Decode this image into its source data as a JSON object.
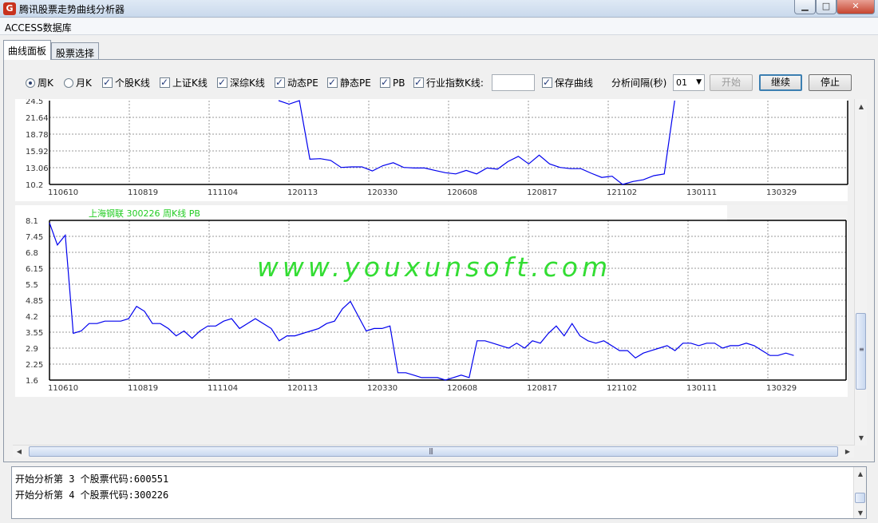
{
  "window": {
    "title": "腾讯股票走势曲线分析器",
    "icon": "app-logo-icon"
  },
  "menu": {
    "label": "ACCESS数据库"
  },
  "tabs": [
    {
      "label": "曲线面板"
    },
    {
      "label": "股票选择"
    }
  ],
  "options": {
    "week_k": {
      "label": "周K",
      "checked": true
    },
    "month_k": {
      "label": "月K",
      "checked": false
    },
    "stock_k": {
      "label": "个股K线",
      "checked": true
    },
    "sh_k": {
      "label": "上证K线",
      "checked": true
    },
    "sz_k": {
      "label": "深综K线",
      "checked": true
    },
    "dyn_pe": {
      "label": "动态PE",
      "checked": true
    },
    "static_pe": {
      "label": "静态PE",
      "checked": true
    },
    "pb": {
      "label": "PB",
      "checked": true
    },
    "industry_k": {
      "label": "行业指数K线:",
      "checked": true,
      "value": ""
    },
    "save_curve": {
      "label": "保存曲线",
      "checked": true
    },
    "interval_label": "分析间隔(秒)",
    "interval_value": "01"
  },
  "buttons": {
    "start": "开始",
    "continue": "继续",
    "stop": "停止"
  },
  "watermark": "www.youxunsoft.com",
  "chart_data": [
    {
      "type": "line",
      "title": "",
      "categories": [
        "110610",
        "110819",
        "111104",
        "120113",
        "120330",
        "120608",
        "120817",
        "121102",
        "130111",
        "130329"
      ],
      "y_ticks": [
        "24.5",
        "21.64",
        "18.78",
        "15.92",
        "13.06",
        "10.2"
      ],
      "ylim": [
        10.2,
        24.5
      ],
      "grid": true,
      "series": [
        {
          "color": "#0000ee",
          "values": [
            24.5,
            23.9,
            24.5,
            14.5,
            14.6,
            14.3,
            13.1,
            13.2,
            13.2,
            12.5,
            13.4,
            13.9,
            13.1,
            13.0,
            13.0,
            12.6,
            12.2,
            12.0,
            12.6,
            12.0,
            13.0,
            12.8,
            14.1,
            15.0,
            13.7,
            15.2,
            13.7,
            13.1,
            12.9,
            12.9,
            12.1,
            11.4,
            11.6,
            10.2,
            10.7,
            11.0,
            11.7,
            12.0,
            24.5
          ]
        }
      ]
    },
    {
      "type": "line",
      "title": "上海钢联  300226  周K线  PB",
      "categories": [
        "110610",
        "110819",
        "111104",
        "120113",
        "120330",
        "120608",
        "120817",
        "121102",
        "130111",
        "130329"
      ],
      "y_ticks": [
        "8.1",
        "7.45",
        "6.8",
        "6.15",
        "5.5",
        "4.85",
        "4.2",
        "3.55",
        "2.9",
        "2.25",
        "1.6"
      ],
      "ylim": [
        1.6,
        8.1
      ],
      "grid": true,
      "series": [
        {
          "name": "上海钢联 300226",
          "color": "#0000ee",
          "values": [
            8.0,
            7.1,
            7.5,
            3.5,
            3.6,
            3.9,
            3.9,
            4.0,
            4.0,
            4.0,
            4.1,
            4.6,
            4.4,
            3.9,
            3.9,
            3.7,
            3.4,
            3.6,
            3.3,
            3.6,
            3.8,
            3.8,
            4.0,
            4.1,
            3.7,
            3.9,
            4.1,
            3.9,
            3.7,
            3.2,
            3.4,
            3.4,
            3.5,
            3.6,
            3.7,
            3.9,
            4.0,
            4.5,
            4.8,
            4.2,
            3.6,
            3.7,
            3.7,
            3.8,
            1.9,
            1.9,
            1.8,
            1.7,
            1.7,
            1.7,
            1.6,
            1.7,
            1.8,
            1.7,
            3.2,
            3.2,
            3.1,
            3.0,
            2.9,
            3.1,
            2.9,
            3.2,
            3.1,
            3.5,
            3.8,
            3.4,
            3.9,
            3.4,
            3.2,
            3.1,
            3.2,
            3.0,
            2.8,
            2.8,
            2.5,
            2.7,
            2.8,
            2.9,
            3.0,
            2.8,
            3.1,
            3.1,
            3.0,
            3.1,
            3.1,
            2.9,
            3.0,
            3.0,
            3.1,
            3.0,
            2.8,
            2.6,
            2.6,
            2.7,
            2.6
          ]
        }
      ]
    }
  ],
  "log": {
    "lines": [
      "开始分析第 3 个股票代码:600551",
      "开始分析第 4 个股票代码:300226"
    ]
  }
}
